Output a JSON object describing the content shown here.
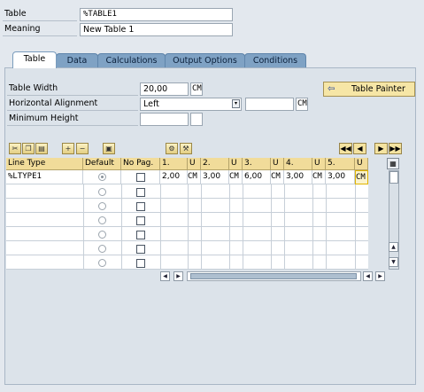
{
  "header": {
    "table_label": "Table",
    "table_value": "%TABLE1",
    "meaning_label": "Meaning",
    "meaning_value": "New Table 1"
  },
  "tabs": [
    "Table",
    "Data",
    "Calculations",
    "Output Options",
    "Conditions"
  ],
  "form": {
    "width_label": "Table Width",
    "width_value": "20,00",
    "width_unit": "CM",
    "halign_label": "Horizontal Alignment",
    "halign_value": "Left",
    "halign_offset": "",
    "halign_unit": "CM",
    "minheight_label": "Minimum Height",
    "minheight_value": "",
    "minheight_unit": ""
  },
  "painter_button": "Table Painter",
  "table": {
    "headers": [
      "Line Type",
      "Default",
      "No Pag.",
      "1.",
      "U",
      "2.",
      "U",
      "3.",
      "U",
      "4.",
      "U",
      "5.",
      "U"
    ],
    "rows": [
      [
        "%LTYPE1",
        "",
        "",
        "2,00",
        "CM",
        "3,00",
        "CM",
        "6,00",
        "CM",
        "3,00",
        "CM",
        "3,00",
        "CM"
      ]
    ]
  },
  "icons": {
    "toolbar": [
      "cut-icon",
      "copy-icon",
      "paste-icon",
      "insert-row-icon",
      "delete-row-icon",
      "lock-icon",
      "settings-icon"
    ],
    "nav": [
      "first-page-icon",
      "previous-page-icon",
      "next-page-icon",
      "last-page-icon"
    ]
  },
  "colors": {
    "background": "#e3e8ee",
    "tab_bg": "#7fa2c4",
    "header_bg": "#f1dc9a",
    "button_bg": "#f6e6a6"
  }
}
